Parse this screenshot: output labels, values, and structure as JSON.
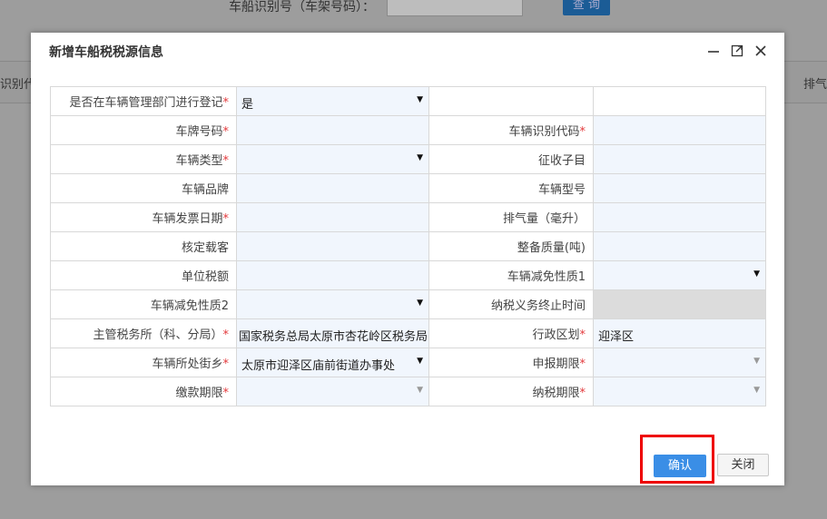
{
  "background": {
    "search_label": "车船识别号（车架号码）：",
    "search_button": "查 询",
    "col_left": "识别代",
    "col_right": "排气"
  },
  "modal": {
    "title": "新增车船税税源信息",
    "rows": [
      {
        "l1": "是否在车辆管理部门进行登记",
        "r1": true,
        "v1": "是",
        "a1": "dark",
        "l2": "",
        "r2": false,
        "v2": "",
        "a2": "none",
        "blank2": true
      },
      {
        "l1": "车牌号码",
        "r1": true,
        "v1": "",
        "a1": "none",
        "l2": "车辆识别代码",
        "r2": true,
        "v2": "",
        "a2": "none"
      },
      {
        "l1": "车辆类型",
        "r1": true,
        "v1": "",
        "a1": "dark",
        "l2": "征收子目",
        "r2": false,
        "v2": "",
        "a2": "none"
      },
      {
        "l1": "车辆品牌",
        "r1": false,
        "v1": "",
        "a1": "none",
        "l2": "车辆型号",
        "r2": false,
        "v2": "",
        "a2": "none"
      },
      {
        "l1": "车辆发票日期",
        "r1": true,
        "v1": "",
        "a1": "none",
        "l2": "排气量（毫升）",
        "r2": false,
        "v2": "",
        "a2": "none"
      },
      {
        "l1": "核定载客",
        "r1": false,
        "v1": "",
        "a1": "none",
        "l2": "整备质量(吨)",
        "r2": false,
        "v2": "",
        "a2": "none"
      },
      {
        "l1": "单位税额",
        "r1": false,
        "v1": "",
        "a1": "none",
        "l2": "车辆减免性质1",
        "r2": false,
        "v2": "",
        "a2": "dark"
      },
      {
        "l1": "车辆减免性质2",
        "r1": false,
        "v1": "",
        "a1": "dark",
        "l2": "纳税义务终止时间",
        "r2": false,
        "v2": "",
        "a2": "none",
        "disabled2": true
      },
      {
        "l1": "主管税务所（科、分局）",
        "r1": true,
        "v1": "国家税务总局太原市杏花岭区税务局",
        "a1": "none",
        "trunc1": true,
        "l2": "行政区划",
        "r2": true,
        "v2": "迎泽区",
        "a2": "none"
      },
      {
        "l1": "车辆所处街乡",
        "r1": true,
        "v1": "太原市迎泽区庙前街道办事处",
        "a1": "dark",
        "l2": "申报期限",
        "r2": true,
        "v2": "",
        "a2": "light"
      },
      {
        "l1": "缴款期限",
        "r1": true,
        "v1": "",
        "a1": "light",
        "l2": "纳税期限",
        "r2": true,
        "v2": "",
        "a2": "light"
      }
    ],
    "required_mark": "*",
    "confirm_button": "确认",
    "close_button": "关闭"
  },
  "icons": {
    "arrow_dark": "▼",
    "arrow_light": "▼",
    "minimize": "minimize-icon",
    "maximize": "maximize-icon",
    "close": "close-icon"
  },
  "colors": {
    "required": "#e3393c",
    "confirm_bg": "#3a8ee6",
    "highlight": "#e00000",
    "field_bg": "#f1f6fd"
  }
}
